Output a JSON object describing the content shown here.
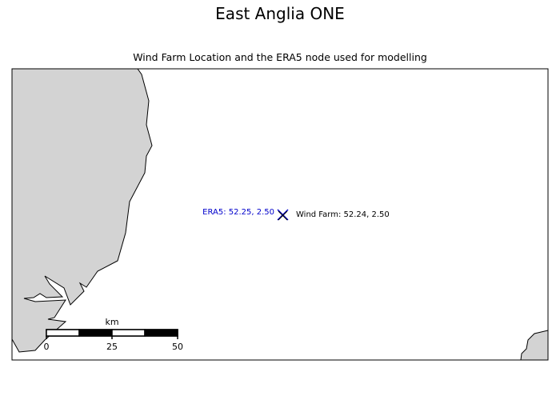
{
  "title": "East Anglia ONE",
  "subtitle": "Wind Farm Location and the ERA5 node used for modelling",
  "map": {
    "land_color": "#d3d3d3",
    "coast_color": "#000000",
    "sea_color": "#ffffff"
  },
  "markers": {
    "era5": {
      "label": "ERA5: 52.25, 2.50",
      "color": "#0000cc"
    },
    "wind_farm": {
      "label": "Wind Farm: 52.24, 2.50",
      "color": "#000000"
    }
  },
  "scale_bar": {
    "unit": "km",
    "ticks": [
      "0",
      "25",
      "50"
    ]
  }
}
